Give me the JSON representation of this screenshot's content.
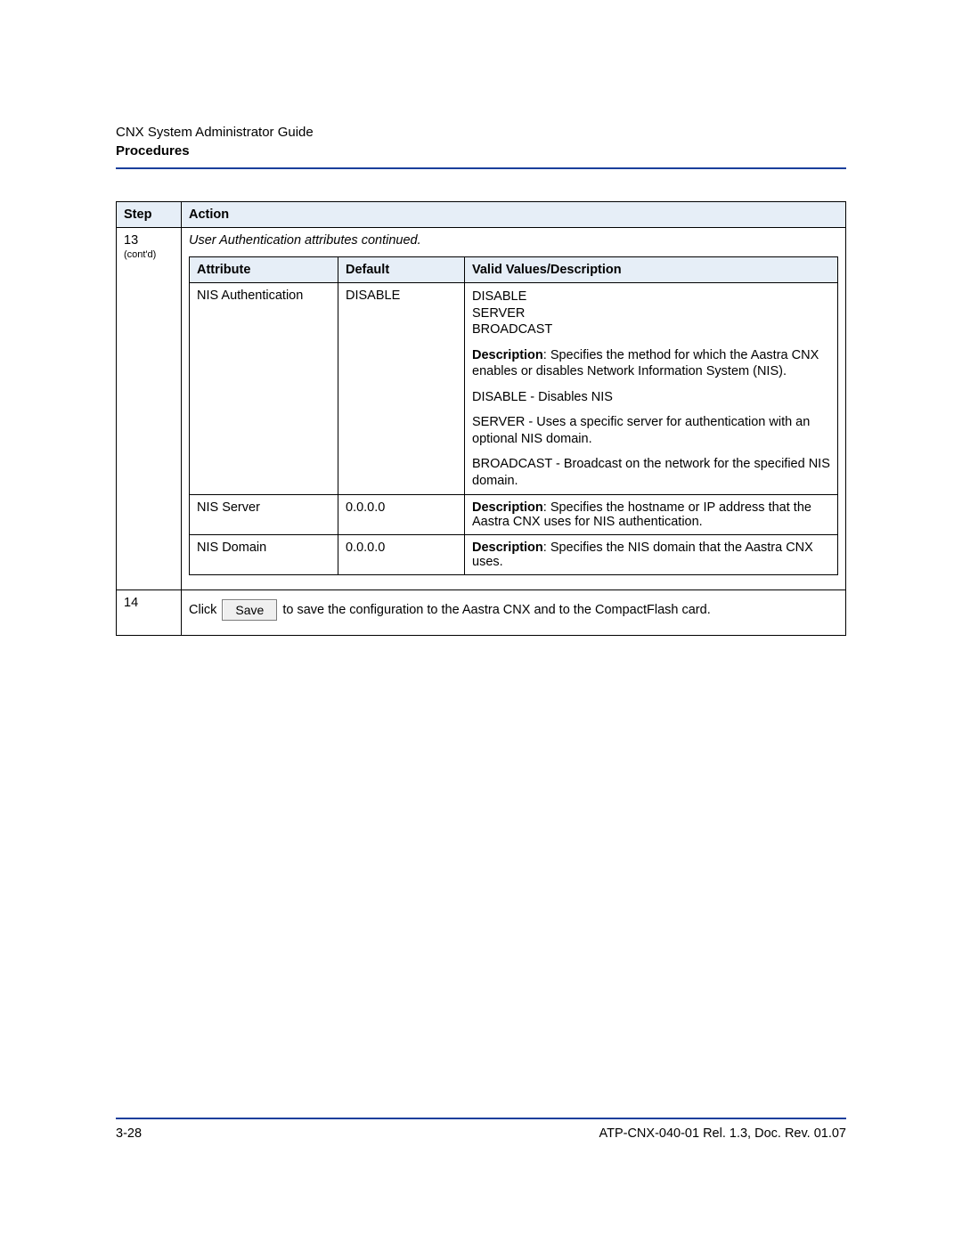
{
  "header": {
    "title": "CNX System Administrator Guide",
    "section": "Procedures"
  },
  "outer_headers": {
    "step": "Step",
    "action": "Action"
  },
  "step13": {
    "step": "13",
    "contd": "(cont'd)",
    "caption": "User Authentication attributes continued.",
    "inner_headers": {
      "attribute": "Attribute",
      "default": "Default",
      "desc": "Valid Values/Description"
    },
    "rows": [
      {
        "attribute": "NIS Authentication",
        "default": "DISABLE",
        "values_line1": "DISABLE",
        "values_line2": "SERVER",
        "values_line3": "BROADCAST",
        "desc_label": "Description",
        "desc_text": ": Specifies the method for which the Aastra CNX enables or disables Network Information System (NIS).",
        "p_disable": "DISABLE - Disables NIS",
        "p_server": "SERVER - Uses a specific server for authentication with an optional NIS domain.",
        "p_broadcast": "BROADCAST - Broadcast on the network for the specified NIS domain."
      },
      {
        "attribute": "NIS Server",
        "default": "0.0.0.0",
        "desc_label": "Description",
        "desc_text": ": Specifies the hostname or IP address that the Aastra CNX uses for NIS authentication."
      },
      {
        "attribute": "NIS Domain",
        "default": "0.0.0.0",
        "desc_label": "Description",
        "desc_text": ": Specifies the NIS domain that the Aastra CNX uses."
      }
    ]
  },
  "step14": {
    "step": "14",
    "pre": "Click",
    "button": "Save",
    "post": "to save the configuration to the Aastra CNX and to the CompactFlash card."
  },
  "footer": {
    "page": "3-28",
    "doc": "ATP-CNX-040-01 Rel. 1.3, Doc. Rev. 01.07"
  }
}
